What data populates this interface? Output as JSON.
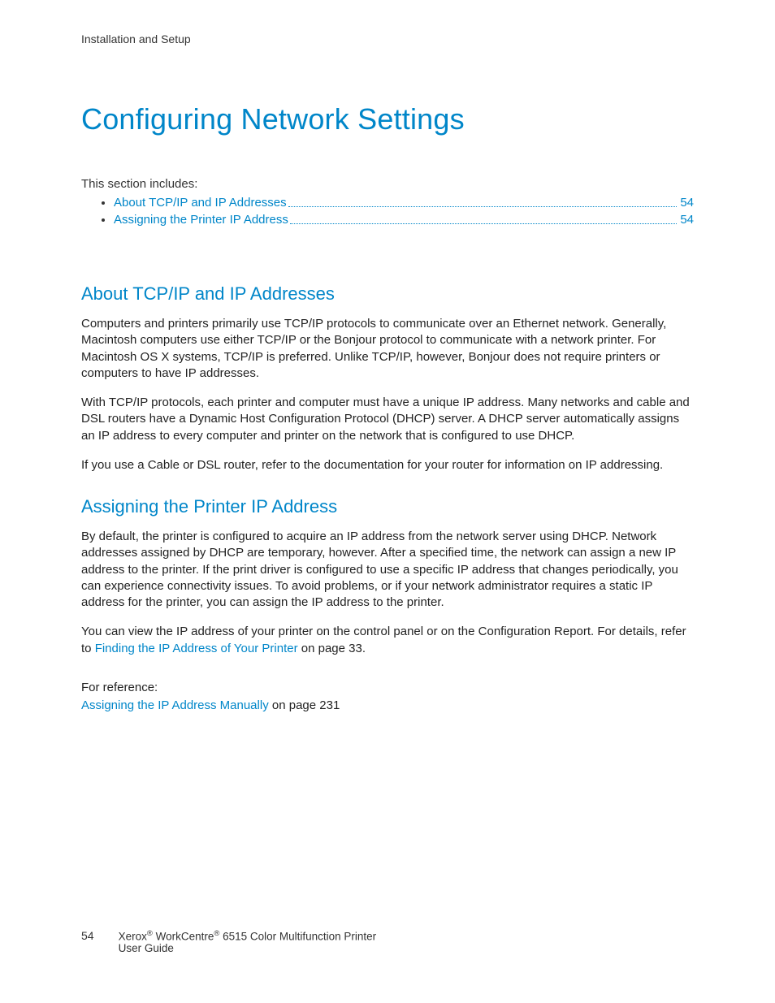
{
  "header": {
    "running": "Installation and Setup"
  },
  "title": "Configuring Network Settings",
  "intro": "This section includes:",
  "toc": [
    {
      "label": "About TCP/IP and IP Addresses",
      "page": "54"
    },
    {
      "label": "Assigning the Printer IP Address",
      "page": "54"
    }
  ],
  "sections": {
    "about": {
      "heading": "About TCP/IP and IP Addresses",
      "p1": "Computers and printers primarily use TCP/IP protocols to communicate over an Ethernet network. Generally, Macintosh computers use either TCP/IP or the Bonjour protocol to communicate with a network printer. For Macintosh OS X systems, TCP/IP is preferred. Unlike TCP/IP, however, Bonjour does not require printers or computers to have IP addresses.",
      "p2": "With TCP/IP protocols, each printer and computer must have a unique IP address. Many networks and cable and DSL routers have a Dynamic Host Configuration Protocol (DHCP) server. A DHCP server automatically assigns an IP address to every computer and printer on the network that is configured to use DHCP.",
      "p3": "If you use a Cable or DSL router, refer to the documentation for your router for information on IP addressing."
    },
    "assign": {
      "heading": "Assigning the Printer IP Address",
      "p1": "By default, the printer is configured to acquire an IP address from the network server using DHCP. Network addresses assigned by DHCP are temporary, however. After a specified time, the network can assign a new IP address to the printer. If the print driver is configured to use a specific IP address that changes periodically, you can experience connectivity issues. To avoid problems, or if your network administrator requires a static IP address for the printer, you can assign the IP address to the printer.",
      "p2_pre": "You can view the IP address of your printer on the control panel or on the Configuration Report. For details, refer to ",
      "p2_link": "Finding the IP Address of Your Printer",
      "p2_post": " on page 33.",
      "ref_label": "For reference:",
      "ref_link": "Assigning the IP Address Manually",
      "ref_post": " on page 231"
    }
  },
  "footer": {
    "page": "54",
    "line1_pre": "Xerox",
    "line1_mid": " WorkCentre",
    "line1_post": " 6515 Color Multifunction Printer",
    "line2": "User Guide"
  }
}
